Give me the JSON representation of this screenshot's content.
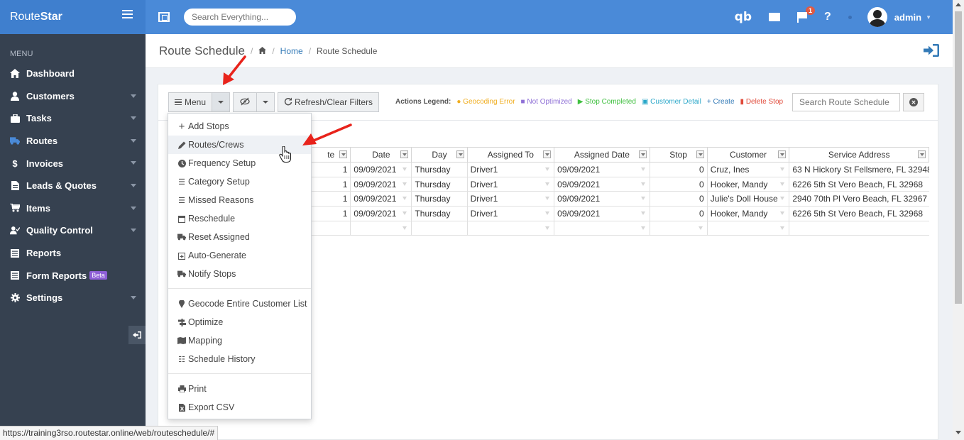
{
  "header": {
    "brand_prefix": "Route",
    "brand_suffix": "Star",
    "search_placeholder": "Search Everything...",
    "qb_label": "qb",
    "notification_count": "1",
    "help_label": "?",
    "user_name": "admin"
  },
  "sidebar": {
    "heading": "MENU",
    "items": [
      {
        "label": "Dashboard",
        "icon": "home-icon"
      },
      {
        "label": "Customers",
        "icon": "user-icon"
      },
      {
        "label": "Tasks",
        "icon": "briefcase-icon"
      },
      {
        "label": "Routes",
        "icon": "truck-icon"
      },
      {
        "label": "Invoices",
        "icon": "dollar-icon"
      },
      {
        "label": "Leads & Quotes",
        "icon": "file-icon"
      },
      {
        "label": "Items",
        "icon": "cart-icon"
      },
      {
        "label": "Quality Control",
        "icon": "user-check-icon"
      },
      {
        "label": "Reports",
        "icon": "list-alt-icon"
      },
      {
        "label": "Form Reports",
        "icon": "list-alt-icon",
        "badge": "Beta"
      },
      {
        "label": "Settings",
        "icon": "gear-icon"
      }
    ]
  },
  "breadcrumb": {
    "page_title": "Route Schedule",
    "home_link": "Home",
    "current": "Route Schedule"
  },
  "toolbar": {
    "menu_label": "Menu",
    "refresh_label": "Refresh/Clear Filters",
    "search_placeholder": "Search Route Schedule"
  },
  "legend": {
    "title": "Actions Legend:",
    "items": [
      {
        "label": "Geocoding Error",
        "color": "#f0ad1f",
        "icon": "globe-icon"
      },
      {
        "label": "Not Optimized",
        "color": "#8e6fd6",
        "icon": "map-icon"
      },
      {
        "label": "Stop Completed",
        "color": "#3fbf3f",
        "icon": "flag-icon"
      },
      {
        "label": "Customer Detail",
        "color": "#2aa7c9",
        "icon": "id-card-icon"
      },
      {
        "label": "Create",
        "color": "#337ab7",
        "icon": "plus-icon"
      },
      {
        "label": "Delete Stop",
        "color": "#e04a3a",
        "icon": "trash-icon"
      }
    ]
  },
  "grid": {
    "columns": [
      "te",
      "Date",
      "Day",
      "Assigned To",
      "Assigned Date",
      "Stop",
      "Customer",
      "Service Address"
    ],
    "rows": [
      [
        "1",
        "09/09/2021",
        "Thursday",
        "Driver1",
        "09/09/2021",
        "0",
        "Cruz, Ines",
        "63 N Hickory St Fellsmere, FL 32948"
      ],
      [
        "1",
        "09/09/2021",
        "Thursday",
        "Driver1",
        "09/09/2021",
        "0",
        "Hooker, Mandy",
        "6226 5th St Vero Beach, FL 32968"
      ],
      [
        "1",
        "09/09/2021",
        "Thursday",
        "Driver1",
        "09/09/2021",
        "0",
        "Julie's Doll House",
        "2940 70th Pl Vero Beach, FL 32967"
      ],
      [
        "1",
        "09/09/2021",
        "Thursday",
        "Driver1",
        "09/09/2021",
        "0",
        "Hooker, Mandy",
        "6226 5th St Vero Beach, FL 32968"
      ]
    ]
  },
  "dropdown": {
    "group1": [
      {
        "label": "Add Stops",
        "icon": "plus-icon"
      },
      {
        "label": "Routes/Crews",
        "icon": "pencil-icon",
        "active": true
      },
      {
        "label": "Frequency Setup",
        "icon": "clock-icon"
      },
      {
        "label": "Category Setup",
        "icon": "list-icon"
      },
      {
        "label": "Missed Reasons",
        "icon": "list-icon"
      },
      {
        "label": "Reschedule",
        "icon": "calendar-icon"
      },
      {
        "label": "Reset Assigned",
        "icon": "truck-icon"
      },
      {
        "label": "Auto-Generate",
        "icon": "calendar-plus-icon"
      },
      {
        "label": "Notify Stops",
        "icon": "truck-icon"
      }
    ],
    "group2": [
      {
        "label": "Geocode Entire Customer List",
        "icon": "map-marker-icon"
      },
      {
        "label": "Optimize",
        "icon": "signpost-icon"
      },
      {
        "label": "Mapping",
        "icon": "map-icon"
      },
      {
        "label": "Schedule History",
        "icon": "tasks-icon"
      }
    ],
    "group3": [
      {
        "label": "Print",
        "icon": "print-icon"
      },
      {
        "label": "Export CSV",
        "icon": "file-excel-icon"
      }
    ]
  },
  "status_url": "https://training3rso.routestar.online/web/routeschedule/#"
}
